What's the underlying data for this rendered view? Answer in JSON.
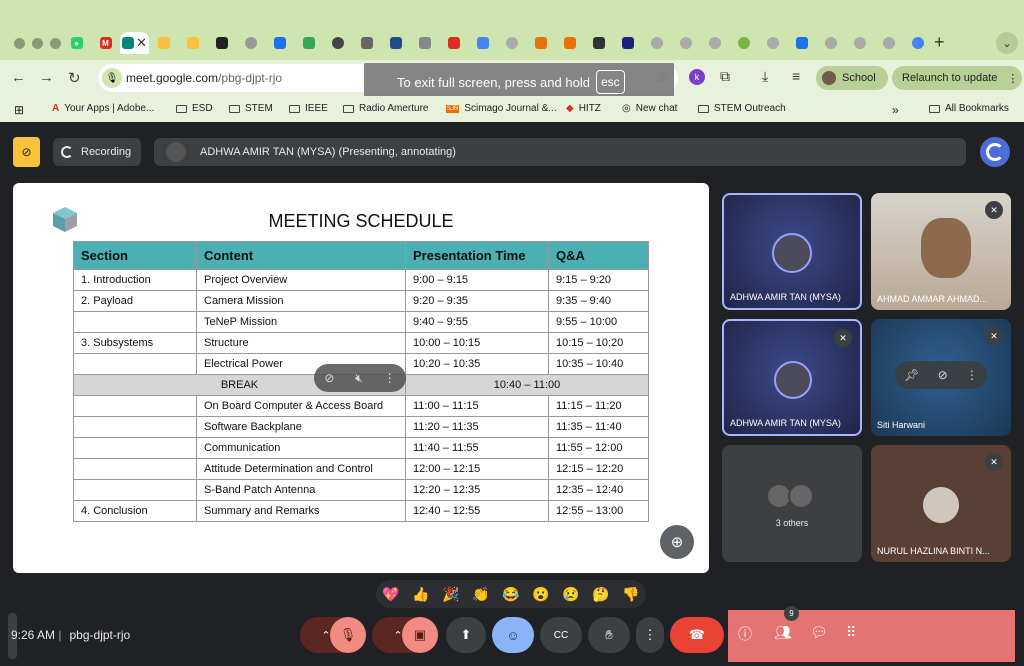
{
  "browser": {
    "url_domain": "meet.google.com",
    "url_path": "/pbg-djpt-rjo",
    "fullscreen_hint": "To exit full screen, press and hold",
    "esc_key": "esc",
    "profile_label": "School",
    "relaunch_label": "Relaunch to update",
    "bookmarks": [
      "Your Apps | Adobe...",
      "ESD",
      "STEM",
      "IEEE",
      "Radio Amerture",
      "Scimago Journal &...",
      "HITZ",
      "New chat",
      "STEM Outreach",
      "All Bookmarks"
    ]
  },
  "meeting": {
    "recording_label": "Recording",
    "presenter_label": "ADHWA AMIR TAN (MYSA) (Presenting, annotating)",
    "time": "9:26 AM",
    "meeting_code": "pbg-djpt-rjo",
    "participant_count": "9",
    "reactions": [
      "💖",
      "👍",
      "🎉",
      "👏",
      "😂",
      "😮",
      "😢",
      "🤔",
      "👎"
    ]
  },
  "slide": {
    "title": "MEETING SCHEDULE",
    "headers": [
      "Section",
      "Content",
      "Presentation Time",
      "Q&A"
    ],
    "rows": [
      [
        "1. Introduction",
        "Project Overview",
        "9:00 – 9:15",
        "9:15 – 9:20"
      ],
      [
        "2. Payload",
        "Camera Mission",
        "9:20 – 9:35",
        "9:35 – 9:40"
      ],
      [
        "",
        "TeNeP Mission",
        "9:40 – 9:55",
        "9:55 – 10:00"
      ],
      [
        "3. Subsystems",
        "Structure",
        "10:00 – 10:15",
        "10:15 – 10:20"
      ],
      [
        "",
        "Electrical Power",
        "10:20 – 10:35",
        "10:35 – 10:40"
      ]
    ],
    "break_label": "BREAK",
    "break_time": "10:40 – 11:00",
    "rows2": [
      [
        "",
        "On Board Computer & Access Board",
        "11:00 – 11:15",
        "11:15 – 11:20"
      ],
      [
        "",
        "Software Backplane",
        "11:20 – 11:35",
        "11:35 – 11:40"
      ],
      [
        "",
        "Communication",
        "11:40 – 11:55",
        "11:55 – 12:00"
      ],
      [
        "",
        "Attitude Determination and Control",
        "12:00 – 12:15",
        "12:15 – 12:20"
      ],
      [
        "",
        "S-Band Patch Antenna",
        "12:20 – 12:35",
        "12:35 – 12:40"
      ],
      [
        "4. Conclusion",
        "Summary and Remarks",
        "12:40 – 12:55",
        "12:55 – 13:00"
      ]
    ]
  },
  "participants": {
    "p1": "ADHWA AMIR TAN (MYSA)",
    "p2": "AHMAD AMMAR AHMAD...",
    "p3": "ADHWA AMIR TAN (MYSA)",
    "p4": "Siti Harwani",
    "others": "3 others",
    "p6": "NURUL HAZLINA BINTI N..."
  }
}
